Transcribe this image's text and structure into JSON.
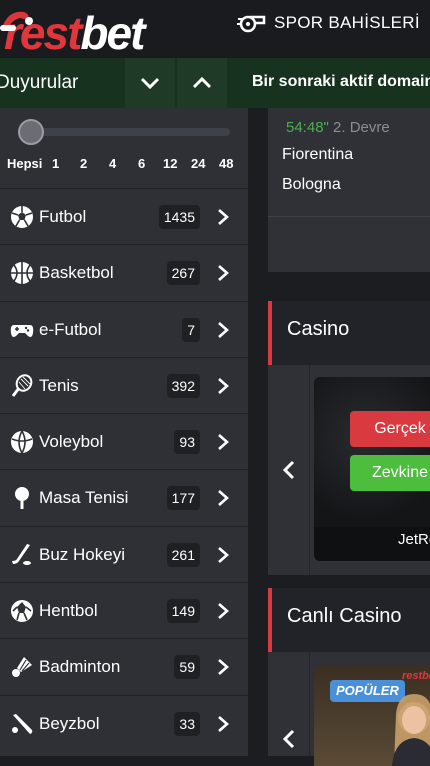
{
  "header": {
    "logo_red": "rest",
    "logo_white": "bet",
    "nav_label": "SPOR BAHİSLERİ"
  },
  "announcements": {
    "title": "Duyurular",
    "message": "Bir sonraki aktif domain"
  },
  "filter": {
    "hours": [
      "Hepsi",
      "1",
      "2",
      "4",
      "6",
      "12",
      "24",
      "48"
    ],
    "slider_level": 0
  },
  "sports": [
    {
      "name": "Futbol",
      "count": "1435",
      "icon": "soccer-ball-icon"
    },
    {
      "name": "Basketbol",
      "count": "267",
      "icon": "basketball-icon"
    },
    {
      "name": "e-Futbol",
      "count": "7",
      "icon": "gamepad-icon"
    },
    {
      "name": "Tenis",
      "count": "392",
      "icon": "tennis-racket-icon"
    },
    {
      "name": "Voleybol",
      "count": "93",
      "icon": "volleyball-icon"
    },
    {
      "name": "Masa Tenisi",
      "count": "177",
      "icon": "table-tennis-icon"
    },
    {
      "name": "Buz Hokeyi",
      "count": "261",
      "icon": "hockey-stick-icon"
    },
    {
      "name": "Hentbol",
      "count": "149",
      "icon": "handball-icon"
    },
    {
      "name": "Badminton",
      "count": "59",
      "icon": "shuttlecock-icon"
    },
    {
      "name": "Beyzbol",
      "count": "33",
      "icon": "baseball-bat-icon"
    }
  ],
  "match": {
    "time": "54:48\"",
    "period": "2. Devre",
    "home": "Fiorentina",
    "away": "Bologna"
  },
  "casino": {
    "title": "Casino",
    "real_button": "Gerçek",
    "fun_button": "Zevkine",
    "game_name": "JetRe"
  },
  "live_casino": {
    "title": "Canlı Casino",
    "badge": "POPÜLER",
    "mini_logo": "restbet"
  },
  "colors": {
    "accent_red": "#d93a3f",
    "live_green": "#4caf50",
    "fun_green": "#4cbd3c",
    "badge_blue": "#4a90d9"
  }
}
